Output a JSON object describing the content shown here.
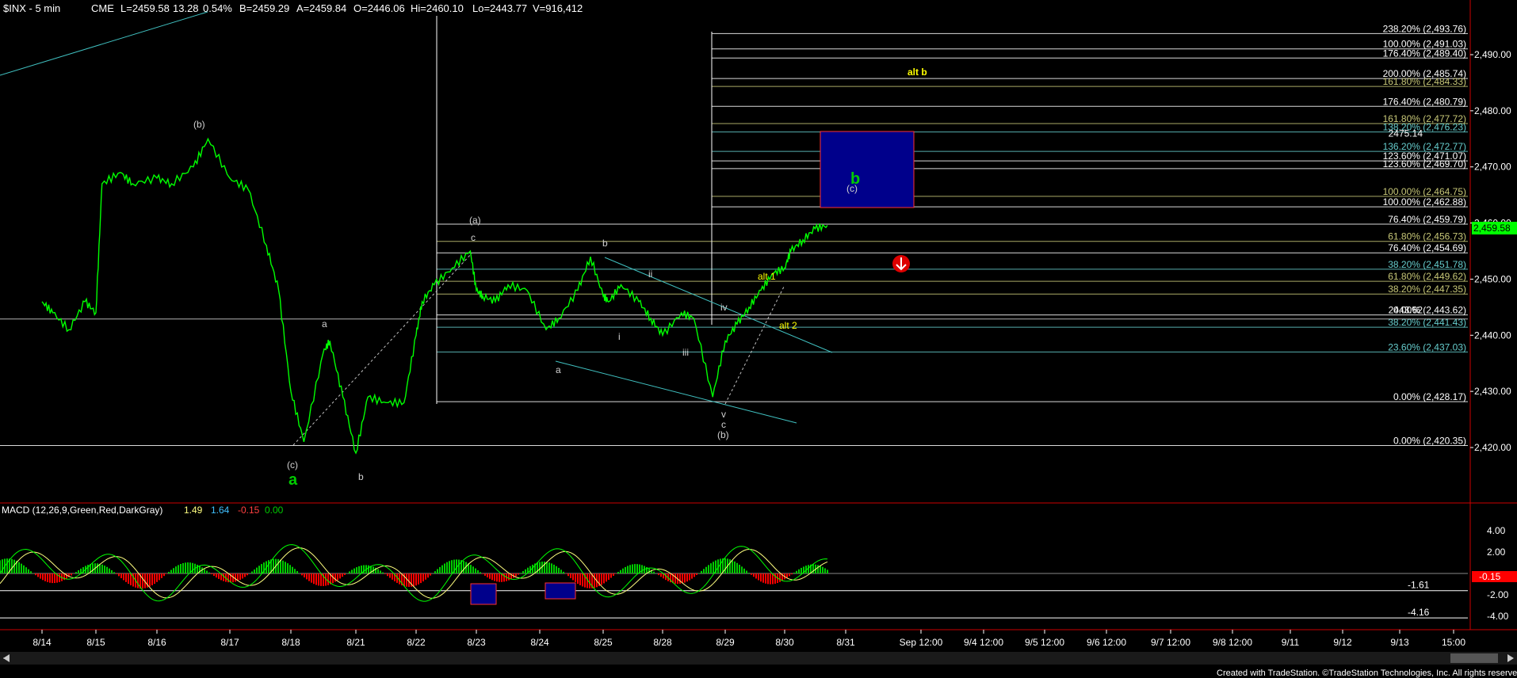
{
  "header": {
    "symbol": "$INX - 5 min",
    "exchange": "CME",
    "last": "L=2459.58",
    "change": "13.28",
    "change_pct": "0.54%",
    "bid": "B=2459.29",
    "ask": "A=2459.84",
    "open": "O=2446.06",
    "high": "Hi=2460.10",
    "low": "Lo=2443.77",
    "volume": "V=916,412"
  },
  "colors": {
    "price": "#00ff00",
    "trend": "#40c0c0",
    "fib_white": "#ffffff",
    "fib_olive": "#c8c878",
    "fib_teal": "#66cccc",
    "target_box": "#00008b",
    "target_border": "#ff3030",
    "macd_line": "#00ff00",
    "signal_line": "#ffff80",
    "hist_pos": "#00cc00",
    "hist_neg": "#ff0000",
    "wave_green": "#00cc00",
    "wave_yellow": "#ffff00",
    "wave_label": "#d0d0d0"
  },
  "chart_data": {
    "type": "line",
    "title": "$INX - 5 min",
    "y_axis": {
      "ticks": [
        "2,490.00",
        "2,480.00",
        "2,470.00",
        "2,460.00",
        "2,450.00",
        "2,440.00",
        "2,430.00",
        "2,420.00"
      ],
      "ylim": [
        2415,
        2497
      ]
    },
    "x_axis": {
      "ticks": [
        "8/14",
        "8/15",
        "8/16",
        "8/17",
        "8/18",
        "8/21",
        "8/22",
        "8/23",
        "8/24",
        "8/25",
        "8/28",
        "8/29",
        "8/30",
        "8/31",
        "Sep 12:00",
        "9/4 12:00",
        "9/5 12:00",
        "9/6 12:00",
        "9/7 12:00",
        "9/8 12:00",
        "9/11",
        "9/12",
        "9/13",
        "15:00"
      ]
    },
    "last_price": "2,459.58",
    "price_path_x": [
      0,
      0.2,
      0.5,
      0.8,
      1.0,
      1.1,
      1.4,
      1.6,
      2.0,
      2.2,
      2.5,
      2.7,
      3.0,
      3.3,
      3.6,
      3.8,
      4.0,
      4.2,
      4.5,
      4.6,
      4.8,
      5.0,
      5.2,
      5.5,
      5.8,
      6.0,
      6.1,
      6.3,
      6.6,
      6.9,
      7.0,
      7.1,
      7.3,
      7.5,
      7.8,
      8.1,
      8.3,
      8.6,
      8.8,
      9.0,
      9.1,
      9.3,
      9.6,
      9.8,
      10.0,
      10.3,
      10.5,
      10.8,
      11.0,
      11.2,
      11.4,
      11.6,
      11.8,
      12.0,
      12.1,
      12.3,
      12.5,
      12.7
    ],
    "price_path_y": [
      2446,
      2444,
      2441,
      2446,
      2444,
      2467,
      2469,
      2467,
      2468,
      2467,
      2470,
      2475,
      2468,
      2466,
      2456,
      2448,
      2430,
      2421,
      2437,
      2439,
      2429,
      2419,
      2429,
      2428,
      2428,
      2440,
      2446,
      2449,
      2452,
      2455,
      2448,
      2447,
      2446,
      2449,
      2448,
      2441,
      2443,
      2448,
      2454,
      2447,
      2446,
      2449,
      2446,
      2443,
      2440,
      2444,
      2443,
      2429,
      2439,
      2442,
      2445,
      2448,
      2451,
      2452,
      2455,
      2457,
      2459,
      2459.58
    ],
    "fib_levels": [
      {
        "label": "238.20% (2,493.76)",
        "value": 2493.76,
        "color": "white"
      },
      {
        "label": "100.00% (2,491.03)",
        "value": 2491.03,
        "color": "white"
      },
      {
        "label": "176.40% (2,489.40)",
        "value": 2489.4,
        "color": "white"
      },
      {
        "label": "200.00% (2,485.74)",
        "value": 2485.74,
        "color": "white"
      },
      {
        "label": "161.80% (2,484.33)",
        "value": 2484.33,
        "color": "olive"
      },
      {
        "label": "176.40% (2,480.79)",
        "value": 2480.79,
        "color": "white"
      },
      {
        "label": "161.80% (2,477.72)",
        "value": 2477.72,
        "color": "olive"
      },
      {
        "label": "138.20% (2,476.23)",
        "value": 2476.23,
        "color": "teal"
      },
      {
        "label": "2475.14",
        "value": 2475.14,
        "color": "white"
      },
      {
        "label": "136.20% (2,472.77)",
        "value": 2472.77,
        "color": "teal"
      },
      {
        "label": "123.60% (2,471.07)",
        "value": 2471.07,
        "color": "white"
      },
      {
        "label": "123.60% (2,469.70)",
        "value": 2469.7,
        "color": "white"
      },
      {
        "label": "100.00% (2,464.75)",
        "value": 2464.75,
        "color": "olive"
      },
      {
        "label": "100.00% (2,462.88)",
        "value": 2462.88,
        "color": "white"
      },
      {
        "label": "76.40% (2,459.79)",
        "value": 2459.79,
        "color": "white"
      },
      {
        "label": "61.80% (2,456.73)",
        "value": 2456.73,
        "color": "olive"
      },
      {
        "label": "76.40% (2,454.69)",
        "value": 2454.69,
        "color": "white"
      },
      {
        "label": "38.20% (2,451.78)",
        "value": 2451.78,
        "color": "teal"
      },
      {
        "label": "61.80% (2,449.62)",
        "value": 2449.62,
        "color": "olive"
      },
      {
        "label": "38.20% (2,447.35)",
        "value": 2447.35,
        "color": "olive"
      },
      {
        "label": "0.00% (2,443.62)",
        "value": 2443.62,
        "color": "white"
      },
      {
        "label": "2443.62",
        "value": 2443.62,
        "color": "white"
      },
      {
        "label": "38.20% (2,441.43)",
        "value": 2441.43,
        "color": "teal"
      },
      {
        "label": "23.60% (2,437.03)",
        "value": 2437.03,
        "color": "teal"
      },
      {
        "label": "0.00% (2,428.17)",
        "value": 2428.17,
        "color": "white"
      },
      {
        "label": "0.00% (2,420.35)",
        "value": 2420.35,
        "color": "white"
      }
    ],
    "wave_labels": {
      "a_green": "a",
      "b_green": "b",
      "alt_b": "alt b",
      "alt_1": "alt 1",
      "alt_2": "alt 2",
      "paren_b": "(b)",
      "paren_c": "(c)",
      "paren_a": "(a)",
      "lower_a": "a",
      "lower_b": "b",
      "lower_c": "c",
      "roman_i": "i",
      "roman_ii": "ii",
      "roman_iii": "iii",
      "roman_iv": "iv",
      "roman_v": "v"
    },
    "macd": {
      "title": "MACD (12,26,9,Green,Red,DarkGray)",
      "macd_value": "1.49",
      "signal_value": "1.64",
      "diff_value": "-0.15",
      "zero_value": "0.00",
      "y_ticks": [
        "4.00",
        "2.00",
        "-2.00",
        "-4.00"
      ],
      "ylim": [
        -5,
        5.6
      ],
      "level_labels": [
        "-1.61",
        "-4.16"
      ],
      "current_label": "-0.15"
    }
  },
  "footer": {
    "credit": "Created with TradeStation. ©TradeStation Technologies, Inc. All rights reserved."
  }
}
